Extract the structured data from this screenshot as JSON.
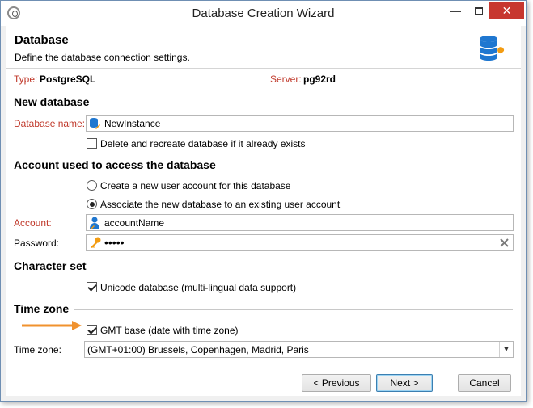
{
  "window": {
    "title": "Database Creation Wizard",
    "minimize_glyph": "—",
    "close_glyph": "✕"
  },
  "header": {
    "title": "Database",
    "subtitle": "Define the database connection settings."
  },
  "info": {
    "type_label": "Type:",
    "type_value": "PostgreSQL",
    "server_label": "Server:",
    "server_value": "pg92rd"
  },
  "new_database": {
    "heading": "New database",
    "name_label": "Database name:",
    "name_value": "NewInstance",
    "recreate_label": "Delete and recreate database if it already exists",
    "recreate_checked": false
  },
  "account": {
    "heading": "Account used to access the database",
    "option_create": "Create a new user account for this database",
    "option_associate": "Associate the new database to an existing user account",
    "selected": "associate",
    "account_label": "Account:",
    "account_value": "accountName",
    "password_label": "Password:",
    "password_value": "•••••"
  },
  "charset": {
    "heading": "Character set",
    "unicode_label": "Unicode database (multi-lingual data support)",
    "unicode_checked": true
  },
  "timezone": {
    "heading": "Time zone",
    "gmt_label": "GMT base (date with time zone)",
    "gmt_checked": true,
    "tz_label": "Time zone:",
    "tz_value": "(GMT+01:00) Brussels, Copenhagen, Madrid, Paris"
  },
  "buttons": {
    "previous": "< Previous",
    "next": "Next >",
    "cancel": "Cancel"
  },
  "colors": {
    "required_label": "#c0392b",
    "arrow": "#f0922e",
    "close_button": "#c7372f",
    "db_icon": "#1f77d0"
  },
  "icons": {
    "database": "database-wrench-icon",
    "field_db": "database-icon",
    "account": "user-icon",
    "password": "key-icon",
    "clear": "clear-x-icon",
    "pointer": "orange-arrow-icon"
  }
}
